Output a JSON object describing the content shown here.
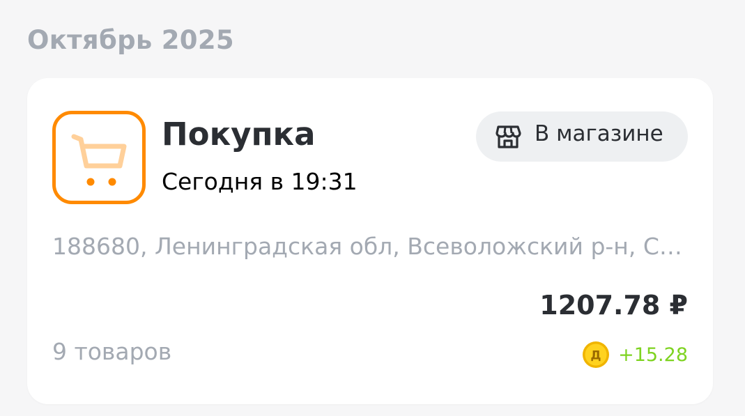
{
  "header": {
    "month": "Октябрь 2025"
  },
  "transaction": {
    "icon": "shopping-cart-icon",
    "type": "Покупка",
    "datetime": "Сегодня в 19:31",
    "channel": {
      "icon": "store-icon",
      "label": "В магазине"
    },
    "address": "188680, Ленинградская обл, Всеволожский р-н, С…",
    "amount": "1207.78 ₽",
    "items_count": "9 товаров",
    "bonus": {
      "icon": "bonus-coin-icon",
      "coin_letter": "Д",
      "value": "+15.28"
    }
  },
  "colors": {
    "accent_orange": "#ff8a00",
    "cart_light": "#ffd09a",
    "bonus_green": "#7ed321",
    "muted_text": "#a3a9b2",
    "primary_text": "#2b2e33",
    "chip_background": "#eef0f2",
    "coin_gold": "#f5c400"
  }
}
